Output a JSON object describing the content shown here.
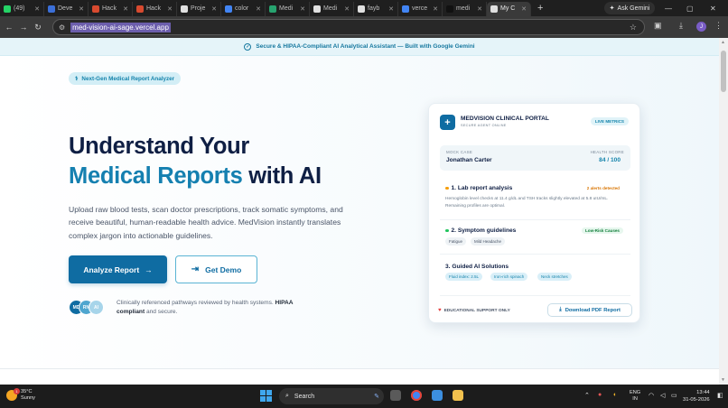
{
  "browser": {
    "tabs": [
      {
        "label": "(49)",
        "color": "#25d366"
      },
      {
        "label": "Deve",
        "color": "#3b6fd8"
      },
      {
        "label": "Hack",
        "color": "#d84a2f"
      },
      {
        "label": "Hack",
        "color": "#d84a2f"
      },
      {
        "label": "Proje",
        "color": "#e0e0e0"
      },
      {
        "label": "color",
        "color": "#4285f4"
      },
      {
        "label": "Medi",
        "color": "#27a36f"
      },
      {
        "label": "Medi",
        "color": "#e0e0e0"
      },
      {
        "label": "fayb",
        "color": "#e0e0e0"
      },
      {
        "label": "verce",
        "color": "#4285f4"
      },
      {
        "label": "medi",
        "color": "#111111"
      },
      {
        "label": "My C",
        "color": "#e0e0e0",
        "active": true
      }
    ],
    "new_tab": "+",
    "ask_gemini": "Ask Gemini",
    "url": "med-vision-ai-sage.vercel.app",
    "profile_initial": "J"
  },
  "page": {
    "banner": "Secure & HIPAA-Compliant AI Analytical Assistant — Built with Google Gemini",
    "badge": "Next-Gen Medical Report Analyzer",
    "headline_line1": "Understand Your",
    "headline_accent": "Medical Reports",
    "headline_rest": " with AI",
    "lead": "Upload raw blood tests, scan doctor prescriptions, track somatic symptoms, and receive beautiful, human-readable health advice. MedVision instantly translates complex jargon into actionable guidelines.",
    "primary_cta": "Analyze Report",
    "secondary_cta": "Get Demo",
    "avatars": [
      {
        "label": "MD",
        "color": "#0f6ca2"
      },
      {
        "label": "RN",
        "color": "#4fa6cf"
      },
      {
        "label": "AI",
        "color": "#a7d5ea"
      }
    ],
    "trust_prefix": "Clinically referenced pathways reviewed by health systems. ",
    "trust_bold": "HIPAA compliant",
    "trust_suffix": " and secure."
  },
  "card": {
    "title": "MEDVISION CLINICAL PORTAL",
    "subtitle": "SECURE AGENT ONLINE",
    "live_badge": "LIVE METRICS",
    "case_label": "MOCK CASE",
    "case_name": "Jonathan Carter",
    "score_label": "HEALTH SCORE",
    "score_value": "84 / 100",
    "section1_title": "1. Lab report analysis",
    "section1_badge": "2 alerts detected",
    "section1_desc": "Hemoglobin level checks at 11.4 g/dL and TSH tracks slightly elevated at 5.8 uIU/mL. Remaining profiles are optimal.",
    "section2_title": "2. Symptom guidelines",
    "section2_badge": "Low-Risk Causes",
    "section2_tags": [
      "Fatigue",
      "Mild Headache"
    ],
    "section3_title": "3. Guided AI Solutions",
    "section3_tags": [
      "Fluid index: 2.5L",
      "Iron-rich spinach",
      "Neck stretches"
    ],
    "edu_label": "EDUCATIONAL SUPPORT ONLY",
    "download_label": "Download PDF Report"
  },
  "taskbar": {
    "temp": "35°C",
    "condition": "Sunny",
    "weather_badge": "1",
    "search": "Search",
    "lang": "ENG",
    "region": "IN",
    "time": "13:44",
    "date": "31-05-2026"
  }
}
